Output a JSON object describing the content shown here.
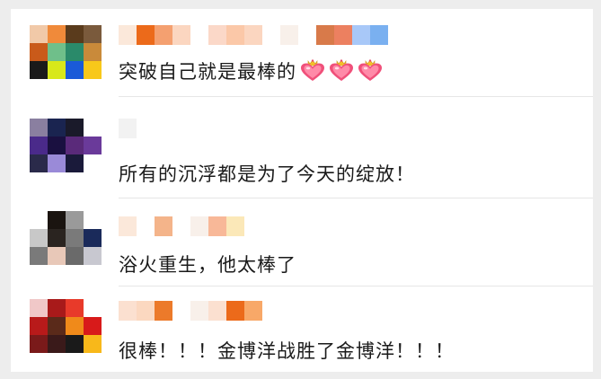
{
  "comments": [
    {
      "text": "突破自己就是最棒的",
      "emoji": [
        "heart-with-crown-icon",
        "heart-with-crown-icon",
        "heart-with-crown-icon"
      ],
      "avatar_colors": [
        "#f1c9a8",
        "#f08a3a",
        "#5a3b1c",
        "#7a5a3c",
        "#c95a1a",
        "#6fbf8a",
        "#2a8a6a",
        "#c98a3a",
        "#1a1a1a",
        "#d8e81a",
        "#1a5ad8",
        "#f8c81a"
      ],
      "name_colors": [
        "#fbe8da",
        "#ec6a1a",
        "#f4a070",
        "#fbd6c0",
        "#ffffff",
        "#fbd8c8",
        "#fbc8a8",
        "#fbd6c0",
        "#ffffff",
        "#f8f0ea",
        "#ffffff",
        "#d87a4a",
        "#ec8060",
        "#a8c8f8",
        "#7ab0f0"
      ]
    },
    {
      "text": "所有的沉浮都是为了今天的绽放！",
      "avatar_colors": [
        "#8a7fa0",
        "#1a2450",
        "#1a1a2a",
        "#ffffff",
        "#4a2a8a",
        "#1a1040",
        "#5a2a7a",
        "#6a3a9a",
        "#2a2a4a",
        "#9a8ad8",
        "#1a1a3a",
        "#ffffff"
      ],
      "name_colors": [
        "#f2f2f2"
      ]
    },
    {
      "text": "浴火重生，他太棒了",
      "avatar_colors": [
        "#ffffff",
        "#1a1410",
        "#9a9a9a",
        "#ffffff",
        "#c8c8c8",
        "#2a2420",
        "#7a7a7a",
        "#1a2a5a",
        "#7a7a7a",
        "#e8c8b8",
        "#6a6a6a",
        "#c8c8d0"
      ],
      "name_colors": [
        "#fbe8da",
        "#ffffff",
        "#f4b48a",
        "#ffffff",
        "#f8f0ea",
        "#f8b898",
        "#fbe8b8"
      ]
    },
    {
      "text": "很棒！！！金博洋战胜了金博洋！！！",
      "avatar_colors": [
        "#f0c8c8",
        "#a81a1a",
        "#e83a2a",
        "#ffffff",
        "#b81a1a",
        "#5a2a1a",
        "#f08a1a",
        "#d81a1a",
        "#7a1a1a",
        "#3a1a1a",
        "#1a1a1a",
        "#f8b81a"
      ],
      "name_colors": [
        "#fbe0d0",
        "#fbd8c0",
        "#ec7a2a",
        "#ffffff",
        "#f8f0ea",
        "#fbe0d0",
        "#ec6a1a",
        "#f8a868"
      ]
    }
  ]
}
